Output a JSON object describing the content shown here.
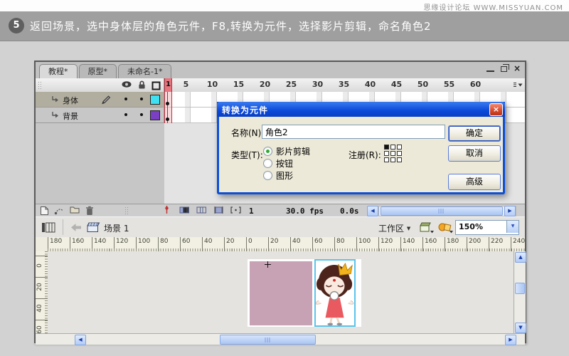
{
  "watermark": "思缘设计论坛 WWW.MISSYUAN.COM",
  "step": {
    "number": "5",
    "text": "返回场景，选中身体层的角色元件，F8,转换为元件，选择影片剪辑，命名角色2"
  },
  "doc_window": {
    "tabs": [
      {
        "label": "教程*",
        "active": true
      },
      {
        "label": "原型*",
        "active": false
      },
      {
        "label": "未命名-1*",
        "active": false
      }
    ]
  },
  "timeline": {
    "playhead_frame": "1",
    "frame_numbers": [
      {
        "label": "5"
      },
      {
        "label": "10"
      },
      {
        "label": "15"
      },
      {
        "label": "20"
      },
      {
        "label": "25"
      },
      {
        "label": "30"
      },
      {
        "label": "35"
      },
      {
        "label": "40"
      },
      {
        "label": "45"
      },
      {
        "label": "50"
      },
      {
        "label": "55"
      },
      {
        "label": "60"
      }
    ],
    "layers": [
      {
        "name": "身体",
        "swatch": "#3fe0f2",
        "editing": true,
        "active": true
      },
      {
        "name": "背景",
        "swatch": "#7b3fc4",
        "editing": false,
        "active": false
      }
    ],
    "status": {
      "current_frame": "1",
      "frame_rate": "30.0 fps",
      "elapsed_time": "0.0s"
    }
  },
  "scene_bar": {
    "scene_name": "场景 1",
    "workspace_label": "工作区",
    "zoom_value": "150%"
  },
  "rulers": {
    "horizontal": [
      {
        "label": "180"
      },
      {
        "label": "160"
      },
      {
        "label": "140"
      },
      {
        "label": "120"
      },
      {
        "label": "100"
      },
      {
        "label": "80"
      },
      {
        "label": "60"
      },
      {
        "label": "40"
      },
      {
        "label": "20"
      },
      {
        "label": "0"
      },
      {
        "label": "20"
      },
      {
        "label": "40"
      },
      {
        "label": "60"
      },
      {
        "label": "80"
      },
      {
        "label": "100"
      },
      {
        "label": "120"
      },
      {
        "label": "140"
      },
      {
        "label": "160"
      },
      {
        "label": "180"
      },
      {
        "label": "200"
      },
      {
        "label": "220"
      },
      {
        "label": "240"
      }
    ],
    "vertical": [
      {
        "label": "0"
      },
      {
        "label": "20"
      },
      {
        "label": "40"
      },
      {
        "label": "60"
      }
    ]
  },
  "dialog": {
    "title": "转换为元件",
    "name_label": "名称(N):",
    "name_value": "角色2",
    "type_label": "类型(T):",
    "type_options": [
      {
        "label": "影片剪辑",
        "selected": true
      },
      {
        "label": "按钮",
        "selected": false
      },
      {
        "label": "图形",
        "selected": false
      }
    ],
    "registration": {
      "label": "注册(R):",
      "selected_index": 0
    },
    "buttons": {
      "ok": "确定",
      "cancel": "取消",
      "advanced": "高级"
    }
  },
  "colors": {
    "stage_fill": "#c7a2b5",
    "selection_outline": "#5ac4ea",
    "step_bar": "#9f9f9f",
    "playhead": "#e8747e",
    "dialog_border": "#0c4fd8"
  }
}
